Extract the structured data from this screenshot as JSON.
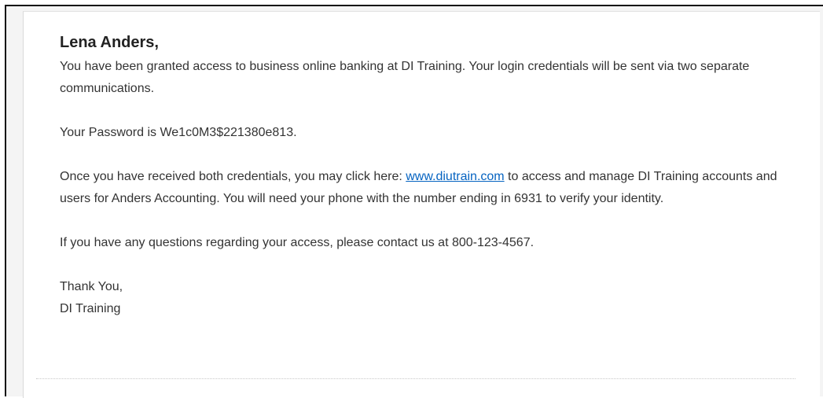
{
  "email": {
    "greeting": "Lena Anders,",
    "intro": "You have been granted access to business online banking at DI Training. Your login credentials will be sent via two separate communications.",
    "password_line": "Your Password is We1c0M3$221380e813.",
    "access_before_link": "Once you have received both credentials, you may click here: ",
    "access_link_text": "www.diutrain.com",
    "access_after_link": " to access and manage DI Training accounts and users for Anders Accounting. You will need your phone with the number ending in 6931 to verify your identity.",
    "questions": "If you have any questions regarding your access, please contact us at 800-123-4567.",
    "closing": "Thank You,",
    "signature": "DI Training"
  },
  "colors": {
    "link": "#0563c1",
    "text": "#333333"
  }
}
